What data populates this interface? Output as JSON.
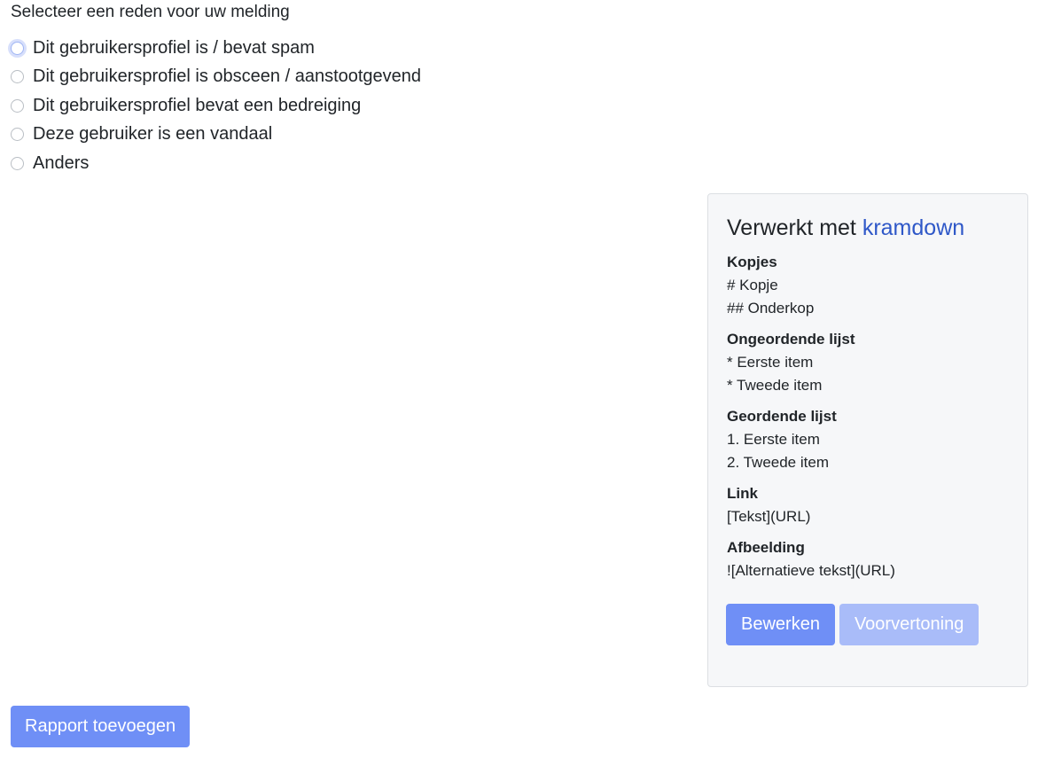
{
  "form": {
    "label": "Selecteer een reden voor uw melding",
    "options": [
      {
        "label": "Dit gebruikersprofiel is / bevat spam"
      },
      {
        "label": "Dit gebruikersprofiel is obsceen / aanstootgevend"
      },
      {
        "label": "Dit gebruikersprofiel bevat een bedreiging"
      },
      {
        "label": "Deze gebruiker is een vandaal"
      },
      {
        "label": "Anders"
      }
    ],
    "submit_label": "Rapport toevoegen"
  },
  "help": {
    "title_prefix": "Verwerkt met ",
    "title_link": "kramdown",
    "sections": [
      {
        "heading": "Kopjes",
        "lines": [
          "# Kopje",
          "## Onderkop"
        ]
      },
      {
        "heading": "Ongeordende lijst",
        "lines": [
          "* Eerste item",
          "* Tweede item"
        ]
      },
      {
        "heading": "Geordende lijst",
        "lines": [
          "1. Eerste item",
          "2. Tweede item"
        ]
      },
      {
        "heading": "Link",
        "lines": [
          "[Tekst](URL)"
        ]
      },
      {
        "heading": "Afbeelding",
        "lines": [
          "![Alternatieve tekst](URL)"
        ]
      }
    ],
    "edit_label": "Bewerken",
    "preview_label": "Voorvertoning"
  },
  "colors": {
    "accent": "#6f8ff6",
    "accent_disabled": "#a9bcf9",
    "link": "#2f58c8",
    "card_bg": "#f6f7f9"
  }
}
